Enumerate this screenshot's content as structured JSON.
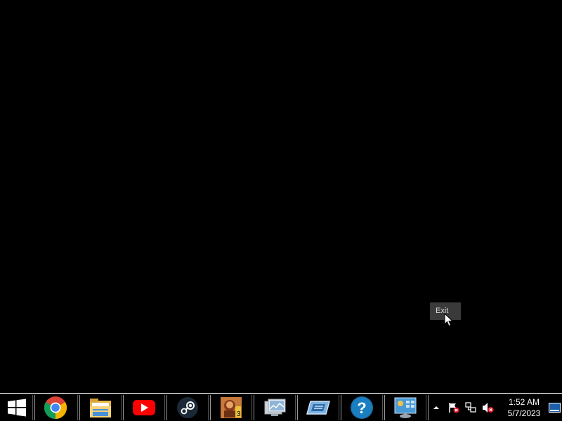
{
  "popup": {
    "label": "Exit"
  },
  "taskbar": {
    "apps": [
      {
        "name": "Google Chrome",
        "icon": "chrome-icon"
      },
      {
        "name": "File Explorer",
        "icon": "folder-icon"
      },
      {
        "name": "YouTube",
        "icon": "youtube-icon"
      },
      {
        "name": "Steam",
        "icon": "steam-icon"
      },
      {
        "name": "Game",
        "icon": "game-icon"
      },
      {
        "name": "Screenshot Viewer",
        "icon": "image-viewer-icon"
      },
      {
        "name": "App",
        "icon": "screen-app-icon"
      },
      {
        "name": "Help",
        "icon": "help-icon"
      },
      {
        "name": "Control Panel",
        "icon": "control-panel-icon"
      }
    ],
    "tray": {
      "icons": [
        "chevron-up-icon",
        "action-center-flag-icon",
        "network-icon",
        "volume-muted-icon"
      ]
    },
    "clock": {
      "time": "1:52 AM",
      "date": "5/7/2023"
    }
  },
  "colors": {
    "taskbar_bg": "#000000",
    "taskbar_border": "#f0f0f0",
    "popup_bg": "#3a3a3a"
  }
}
